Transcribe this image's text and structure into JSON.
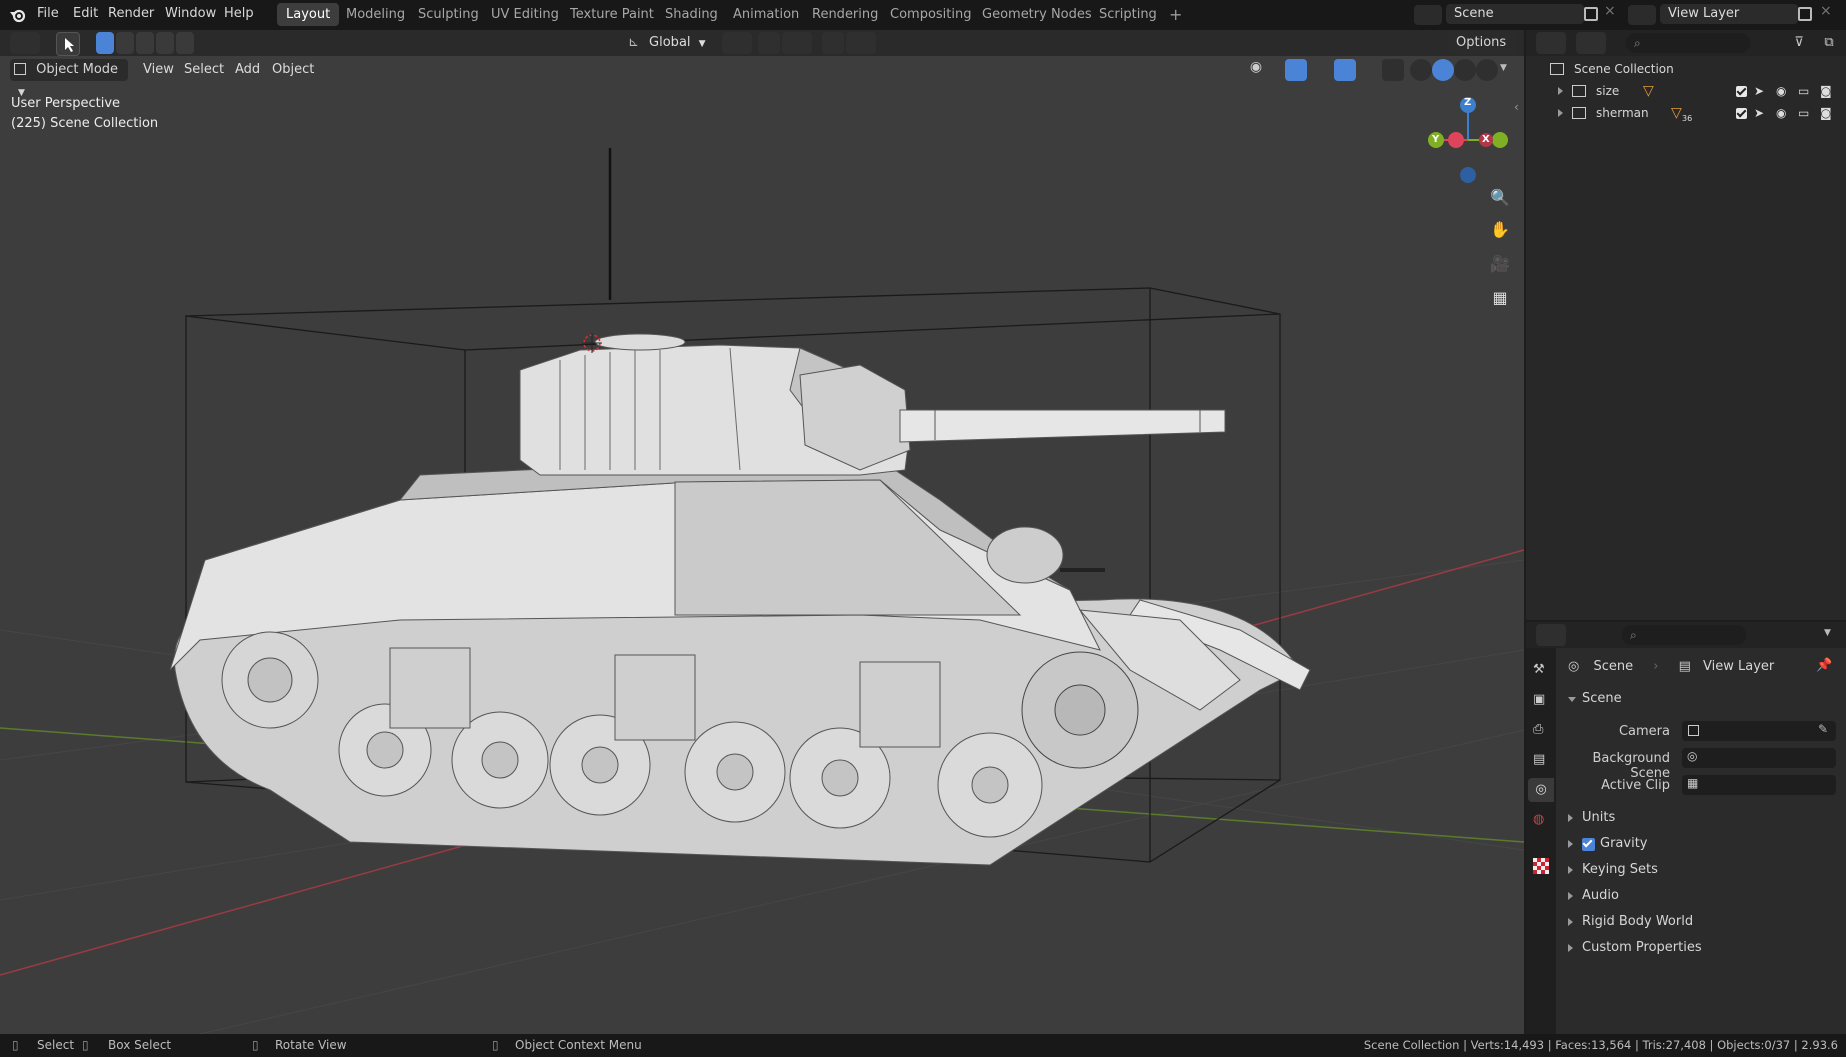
{
  "menu": [
    "File",
    "Edit",
    "Render",
    "Window",
    "Help"
  ],
  "workspaces": [
    "Layout",
    "Modeling",
    "Sculpting",
    "UV Editing",
    "Texture Paint",
    "Shading",
    "Animation",
    "Rendering",
    "Compositing",
    "Geometry Nodes",
    "Scripting"
  ],
  "active_workspace": "Layout",
  "add_tab": "+",
  "scene_name": "Scene",
  "view_layer_name": "View Layer",
  "header": {
    "transform_orientation": "Global",
    "options": "Options",
    "mode": "Object Mode",
    "menus": [
      "View",
      "Select",
      "Add",
      "Object"
    ]
  },
  "viewport": {
    "perspective_label": "User Perspective",
    "collection_label": "(225) Scene Collection",
    "gizmo": {
      "x": "X",
      "y": "Y",
      "z": "Z"
    }
  },
  "outliner": {
    "root": "Scene Collection",
    "items": [
      {
        "name": "size",
        "icon_badge": ""
      },
      {
        "name": "sherman",
        "icon_badge": "36"
      }
    ]
  },
  "properties": {
    "breadcrumb": [
      "Scene",
      "View Layer"
    ],
    "panel_title": "Scene",
    "fields": [
      {
        "label": "Camera"
      },
      {
        "label": "Background Scene"
      },
      {
        "label": "Active Clip"
      }
    ],
    "sections": [
      "Units",
      "Gravity",
      "Keying Sets",
      "Audio",
      "Rigid Body World",
      "Custom Properties"
    ],
    "gravity_enabled": true
  },
  "statusbar": {
    "select": "Select",
    "box_select": "Box Select",
    "rotate": "Rotate View",
    "context_menu": "Object Context Menu",
    "stats": "Scene Collection | Verts:14,493 | Faces:13,564 | Tris:27,408 | Objects:0/37 | 2.93.6"
  },
  "colors": {
    "accent_blue": "#4b84d6",
    "viewport_bg": "#3d3d3d",
    "axis_x": "#e0445a",
    "axis_y": "#7fb023",
    "axis_z": "#3d7fcf",
    "outliner_icon": "#e59a3a"
  }
}
